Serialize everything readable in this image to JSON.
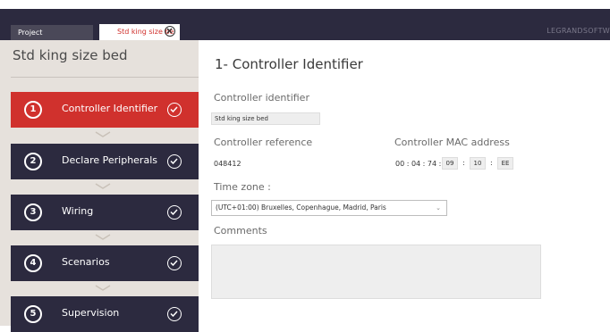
{
  "tabs": {
    "project": "Project",
    "active": "Std king size be"
  },
  "brand": "LEGRANDSOFTW",
  "sidebar": {
    "project_title": "Std king size bed",
    "steps": [
      {
        "num": "1",
        "label": "Controller Identifier"
      },
      {
        "num": "2",
        "label": "Declare Peripherals"
      },
      {
        "num": "3",
        "label": "Wiring"
      },
      {
        "num": "4",
        "label": "Scenarios"
      },
      {
        "num": "5",
        "label": "Supervision"
      }
    ]
  },
  "main": {
    "title": "1- Controller Identifier",
    "controller_identifier_label": "Controller identifier",
    "controller_identifier_value": "Std king size bed",
    "controller_reference_label": "Controller reference",
    "controller_reference_value": "048412",
    "mac_label": "Controller MAC address",
    "mac_prefix": "00 : 04 : 74 :",
    "mac_parts": [
      "09",
      "10",
      "EE"
    ],
    "mac_sep": ":",
    "timezone_label": "Time zone :",
    "timezone_value": "(UTC+01:00) Bruxelles, Copenhague, Madrid, Paris",
    "comments_label": "Comments"
  },
  "colors": {
    "accent": "#d0312d",
    "dark": "#2c2a3f",
    "sidebar": "#e6e1dc"
  }
}
